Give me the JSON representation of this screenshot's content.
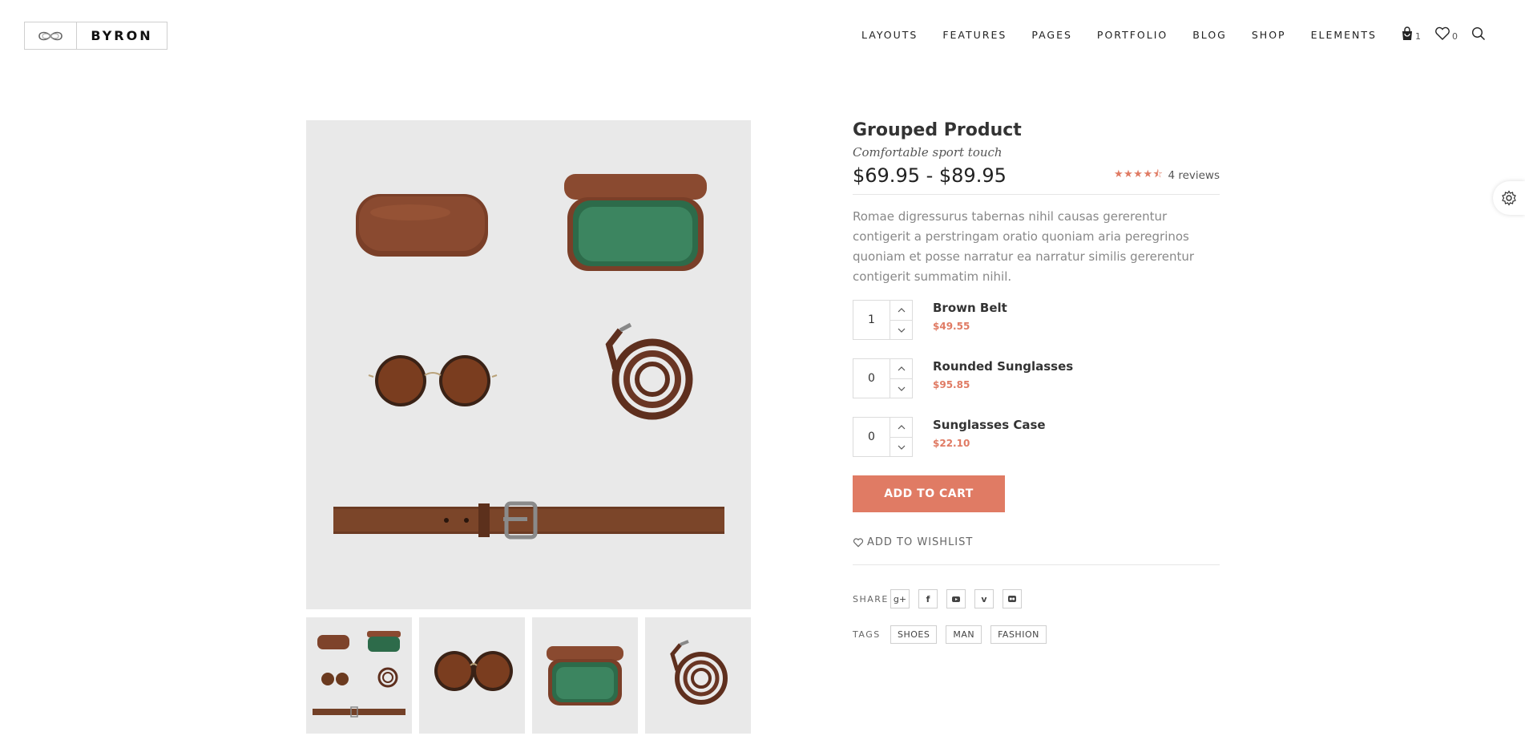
{
  "brand": {
    "name": "BYRON"
  },
  "nav": {
    "items": [
      "LAYOUTS",
      "FEATURES",
      "PAGES",
      "PORTFOLIO",
      "BLOG",
      "SHOP",
      "ELEMENTS"
    ],
    "cart_count": "1",
    "wishlist_count": "0",
    "icons": [
      "cart-icon",
      "heart-icon",
      "search-icon"
    ]
  },
  "product": {
    "title": "Grouped Product",
    "subtitle": "Comfortable sport touch",
    "price_range": "$69.95 - $89.95",
    "rating": 4.5,
    "reviews": "4 reviews",
    "description": "Romae digressurus tabernas nihil causas gererentur contigerit a perstringam oratio quoniam aria peregrinos quoniam et posse narratur ea narratur similis gererentur contigerit summatim nihil.",
    "items": [
      {
        "qty": "1",
        "name": "Brown Belt",
        "price": "$49.55"
      },
      {
        "qty": "0",
        "name": "Rounded Sunglasses",
        "price": "$95.85"
      },
      {
        "qty": "0",
        "name": "Sunglasses Case",
        "price": "$22.10"
      }
    ],
    "add_to_cart": "ADD TO CART",
    "add_to_wishlist": "ADD TO WISHLIST",
    "share_label": "SHARE",
    "share_icons": [
      "google-plus-icon",
      "facebook-icon",
      "youtube-icon",
      "vimeo-icon",
      "flickr-icon"
    ],
    "tags_label": "TAGS",
    "tags": [
      "SHOES",
      "MAN",
      "FASHION"
    ]
  },
  "colors": {
    "accent": "#e07b64",
    "image_bg": "#e9e9e9",
    "text": "#333333"
  }
}
